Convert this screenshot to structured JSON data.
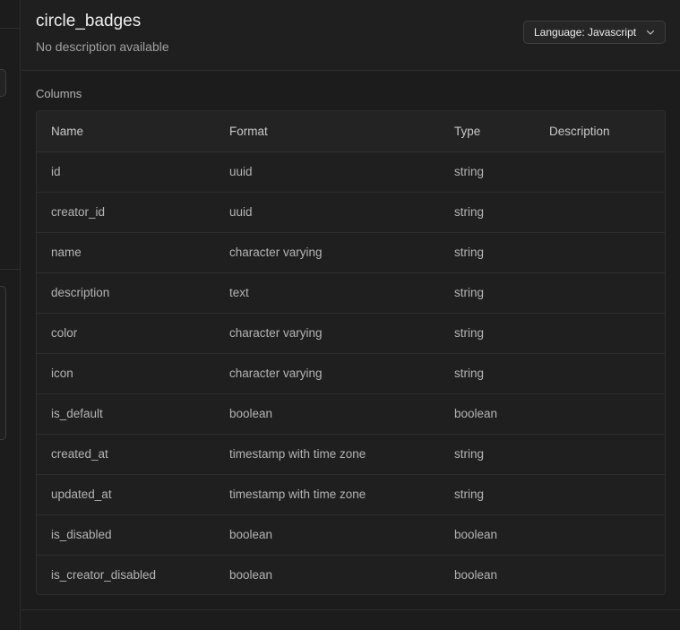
{
  "header": {
    "title": "circle_badges",
    "description": "No description available",
    "language_button": "Language: Javascript"
  },
  "columns_section": {
    "label": "Columns",
    "headers": [
      "Name",
      "Format",
      "Type",
      "Description"
    ],
    "rows": [
      {
        "name": "id",
        "format": "uuid",
        "type": "string",
        "description": ""
      },
      {
        "name": "creator_id",
        "format": "uuid",
        "type": "string",
        "description": ""
      },
      {
        "name": "name",
        "format": "character varying",
        "type": "string",
        "description": ""
      },
      {
        "name": "description",
        "format": "text",
        "type": "string",
        "description": ""
      },
      {
        "name": "color",
        "format": "character varying",
        "type": "string",
        "description": ""
      },
      {
        "name": "icon",
        "format": "character varying",
        "type": "string",
        "description": ""
      },
      {
        "name": "is_default",
        "format": "boolean",
        "type": "boolean",
        "description": ""
      },
      {
        "name": "created_at",
        "format": "timestamp with time zone",
        "type": "string",
        "description": ""
      },
      {
        "name": "updated_at",
        "format": "timestamp with time zone",
        "type": "string",
        "description": ""
      },
      {
        "name": "is_disabled",
        "format": "boolean",
        "type": "boolean",
        "description": ""
      },
      {
        "name": "is_creator_disabled",
        "format": "boolean",
        "type": "boolean",
        "description": ""
      }
    ]
  },
  "icons": {
    "language_dropdown": "chevron-down-icon"
  },
  "colors": {
    "background": "#1c1c1c",
    "panel": "#1f1f1f",
    "border": "#2e2e2e",
    "text_primary": "#ededed",
    "text_secondary": "#b4b4b4"
  }
}
